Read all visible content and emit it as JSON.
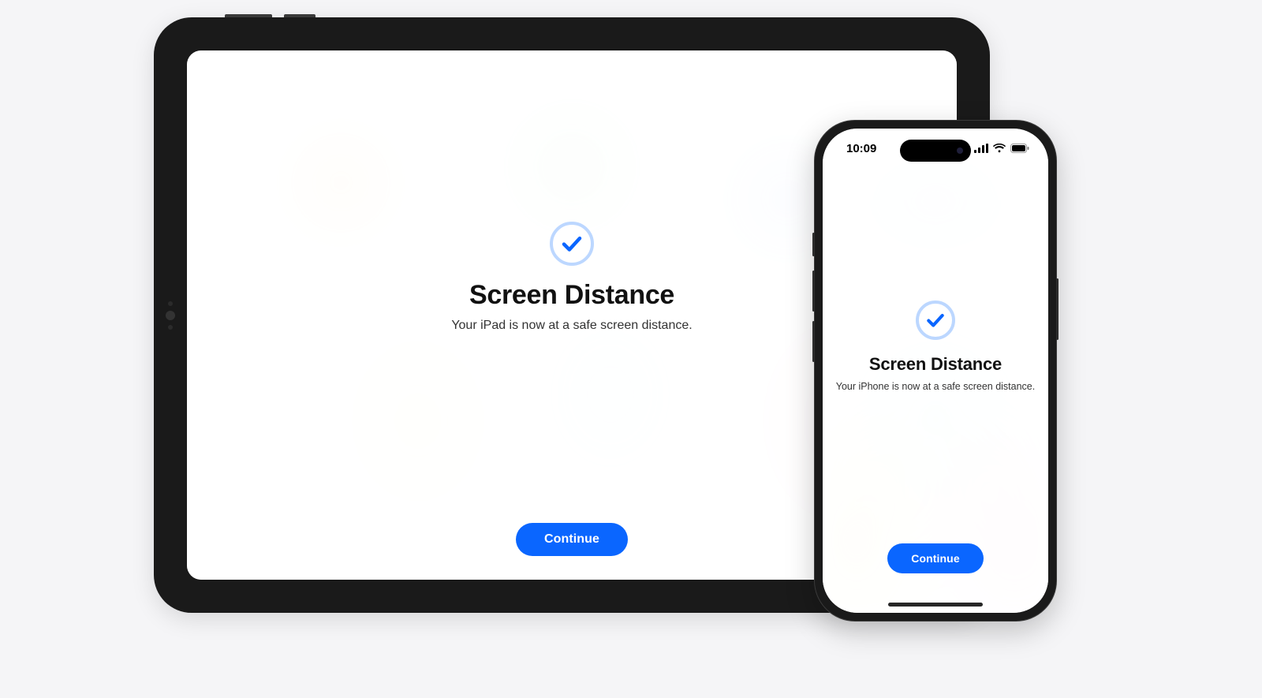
{
  "colors": {
    "accent": "#0a66ff",
    "check_ring": "#bcd7ff"
  },
  "ipad": {
    "icon": "checkmark-circle",
    "title": "Screen Distance",
    "subtitle": "Your iPad is now at a safe screen distance.",
    "button_label": "Continue"
  },
  "iphone": {
    "status": {
      "time": "10:09"
    },
    "icon": "checkmark-circle",
    "title": "Screen Distance",
    "subtitle": "Your iPhone is now at a safe screen distance.",
    "button_label": "Continue"
  }
}
